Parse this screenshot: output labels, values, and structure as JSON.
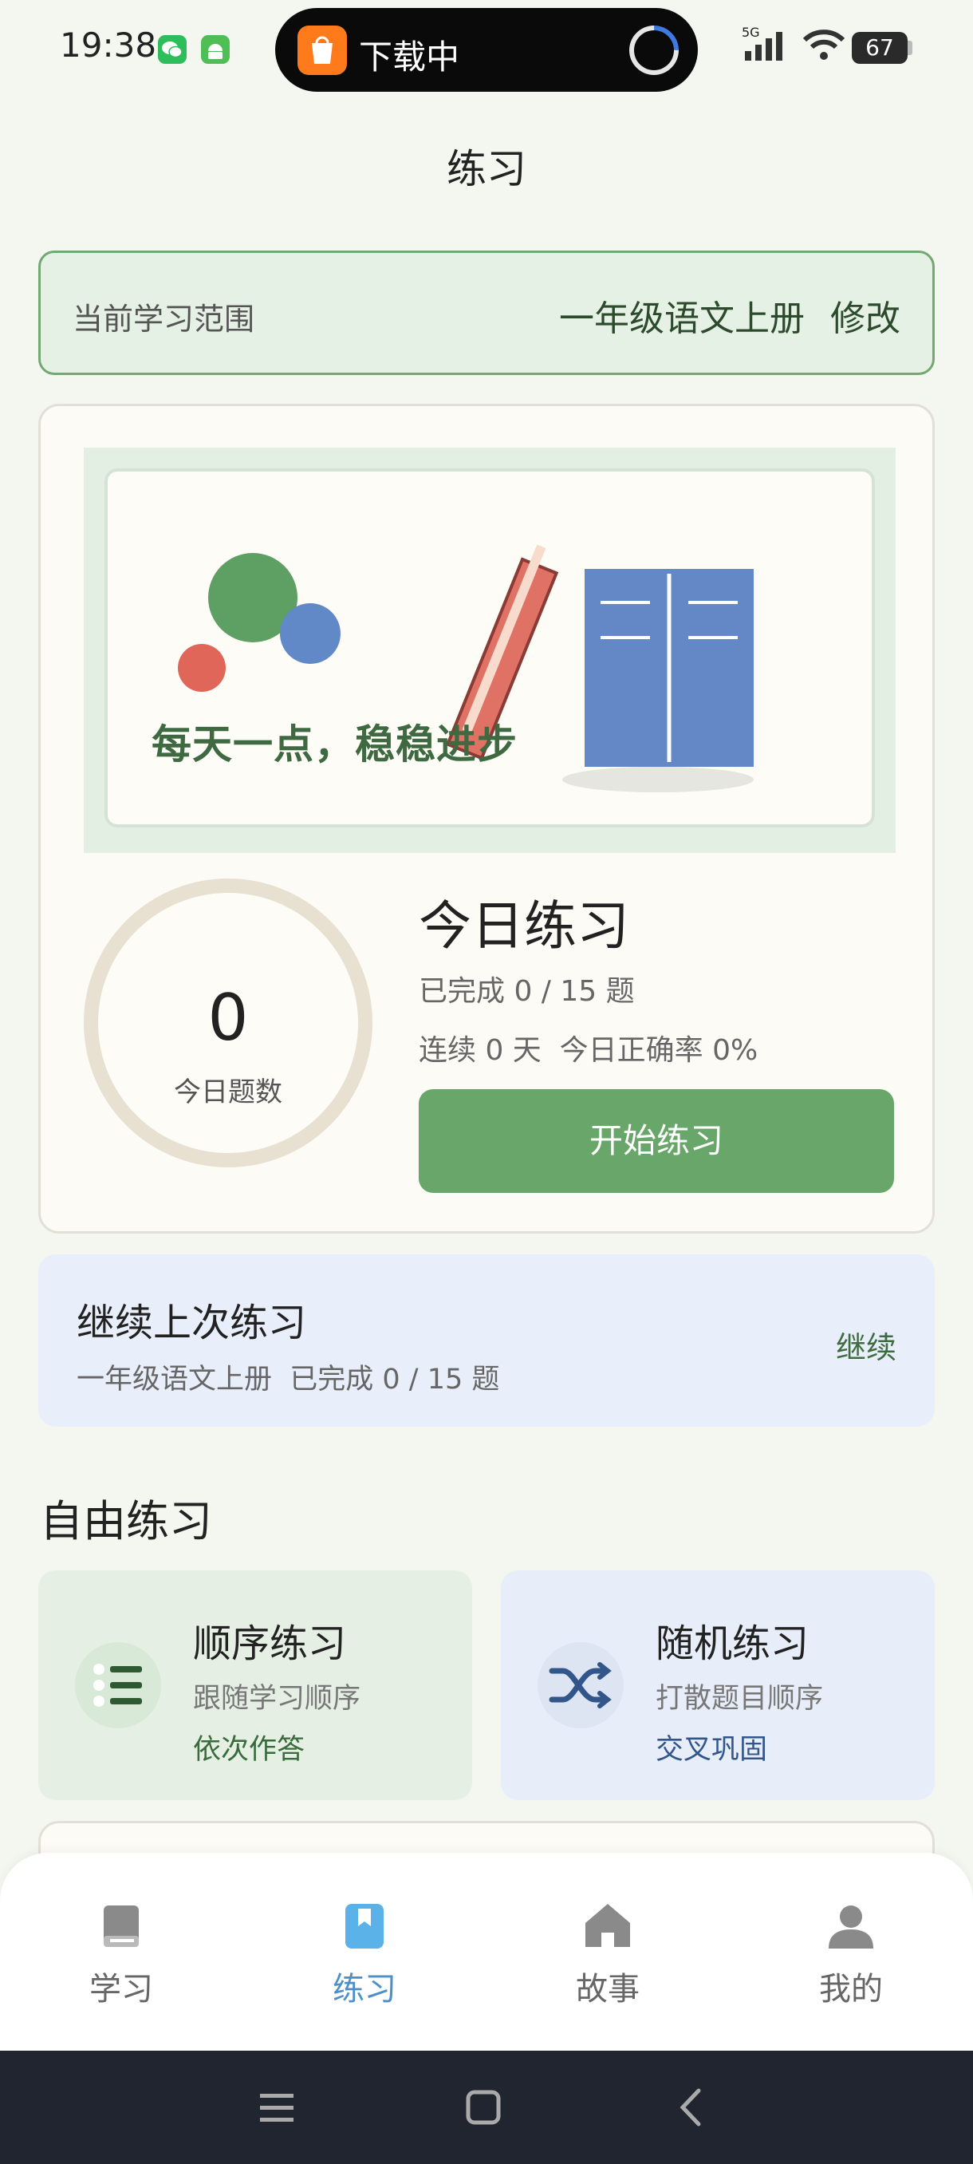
{
  "status_bar": {
    "time": "19:38",
    "download_text": "下载中",
    "network": "5G",
    "battery": "67",
    "icons": [
      "wechat-icon",
      "android-icon",
      "mi-store-icon",
      "signal-icon",
      "wifi-icon",
      "battery-icon"
    ]
  },
  "header": {
    "title": "练习"
  },
  "scope": {
    "label": "当前学习范围",
    "value": "一年级语文上册",
    "edit": "修改"
  },
  "banner": {
    "slogan": "每天一点，稳稳进步"
  },
  "today": {
    "count": "0",
    "count_label": "今日题数",
    "title": "今日练习",
    "done": "已完成 0 / 15 题",
    "stats": "连续 0 天  今日正确率 0%",
    "start_button": "开始练习"
  },
  "continue": {
    "title": "继续上次练习",
    "subtitle": "一年级语文上册  已完成 0 / 15 题",
    "action": "继续"
  },
  "free_practice": {
    "title": "自由练习",
    "modes": [
      {
        "title": "顺序练习",
        "desc": "跟随学习顺序",
        "tag": "依次作答",
        "icon": "list-icon"
      },
      {
        "title": "随机练习",
        "desc": "打散题目顺序",
        "tag": "交叉巩固",
        "icon": "shuffle-icon"
      }
    ]
  },
  "tabbar": {
    "active_color": "#4d90c9",
    "tabs": [
      {
        "label": "学习",
        "icon": "book-icon"
      },
      {
        "label": "练习",
        "icon": "bookmark-icon"
      },
      {
        "label": "故事",
        "icon": "home-icon"
      },
      {
        "label": "我的",
        "icon": "user-icon"
      }
    ]
  },
  "colors": {
    "primary_green": "#69a66a",
    "scope_border": "#74a872",
    "continue_bg": "#e9effa"
  }
}
